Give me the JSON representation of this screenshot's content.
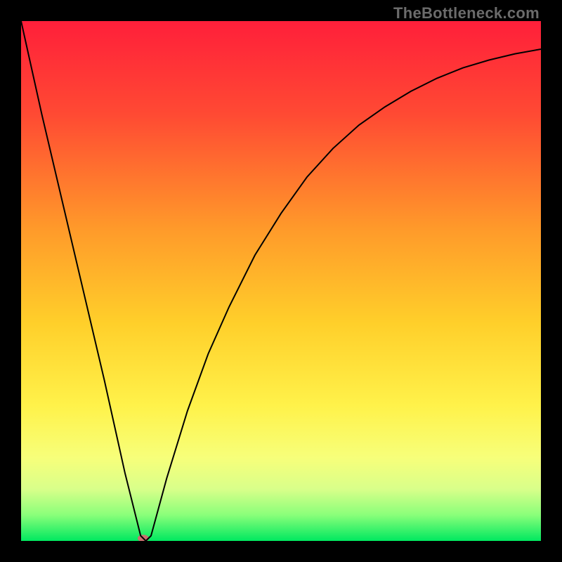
{
  "watermark": "TheBottleneck.com",
  "chart_data": {
    "type": "line",
    "title": "",
    "xlabel": "",
    "ylabel": "",
    "xlim": [
      0,
      100
    ],
    "ylim": [
      0,
      100
    ],
    "grid": false,
    "legend": null,
    "background_gradient": {
      "stops": [
        {
          "offset": 0.0,
          "color": "#ff1f3a"
        },
        {
          "offset": 0.18,
          "color": "#ff4a33"
        },
        {
          "offset": 0.4,
          "color": "#ff9a2a"
        },
        {
          "offset": 0.58,
          "color": "#ffcf2a"
        },
        {
          "offset": 0.74,
          "color": "#fff24a"
        },
        {
          "offset": 0.84,
          "color": "#f7ff7a"
        },
        {
          "offset": 0.9,
          "color": "#d9ff8a"
        },
        {
          "offset": 0.95,
          "color": "#8aff7a"
        },
        {
          "offset": 1.0,
          "color": "#00e860"
        }
      ]
    },
    "series": [
      {
        "name": "curve",
        "stroke": "#000000",
        "stroke_width": 2,
        "x": [
          0,
          4,
          8,
          12,
          16,
          20,
          22,
          23,
          24,
          25,
          28,
          32,
          36,
          40,
          45,
          50,
          55,
          60,
          65,
          70,
          75,
          80,
          85,
          90,
          95,
          100
        ],
        "y": [
          100,
          82,
          65,
          48,
          31,
          13,
          5,
          1,
          0,
          1,
          12,
          25,
          36,
          45,
          55,
          63,
          70,
          75.5,
          80,
          83.5,
          86.5,
          89,
          91,
          92.5,
          93.7,
          94.6
        ]
      }
    ],
    "markers": [
      {
        "name": "min-marker",
        "x": 23.5,
        "y": 0.5,
        "rx": 8,
        "ry": 5,
        "fill": "#cc6f6f"
      }
    ]
  }
}
